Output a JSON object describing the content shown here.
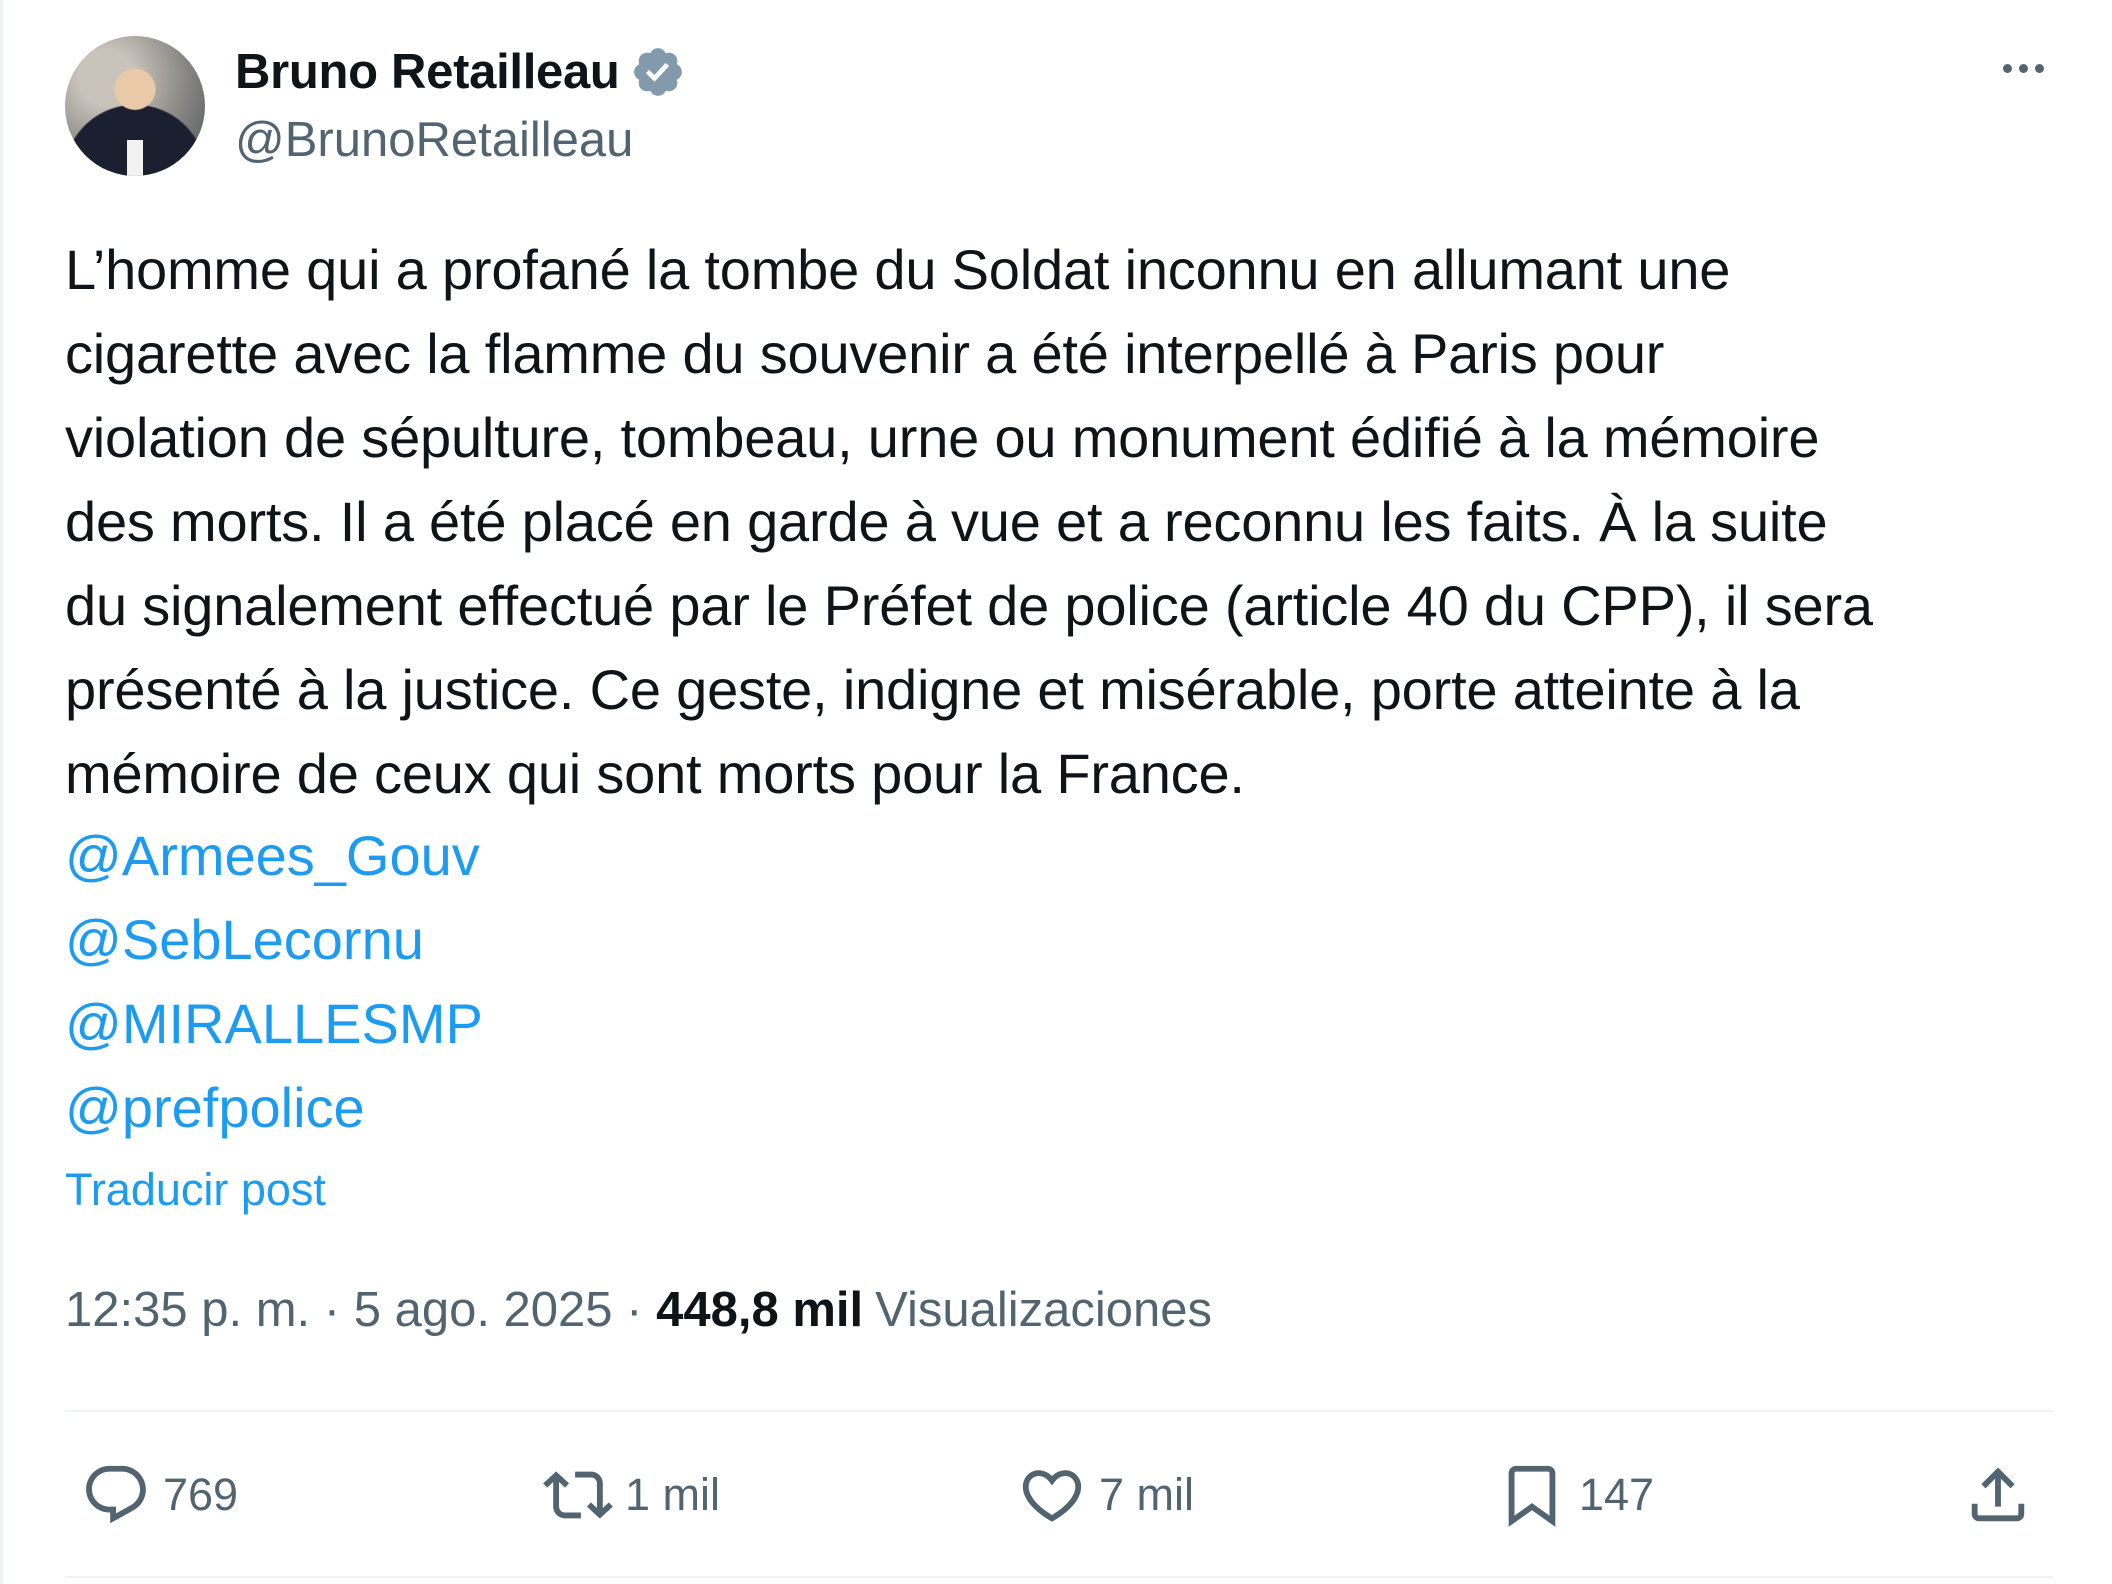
{
  "author": {
    "name": "Bruno Retailleau",
    "handle": "@BrunoRetailleau"
  },
  "body_lines": [
    "L’homme qui a profané la tombe du Soldat inconnu en allumant une",
    "cigarette avec la flamme du souvenir a été interpellé à Paris pour",
    "violation de sépulture, tombeau, urne ou monument édifié à la mémoire",
    "des morts. Il a été placé en garde à vue et a reconnu les faits. À la suite",
    "du signalement effectué par le Préfet de police (article 40 du CPP), il sera",
    "présenté à la justice. Ce geste, indigne et misérable, porte atteinte à la",
    "mémoire de ceux qui sont morts pour la France."
  ],
  "mentions": [
    "@Armees_Gouv",
    "@SebLecornu",
    "@MIRALLESMP",
    "@prefpolice"
  ],
  "translate_label": "Traducir post",
  "meta": {
    "time": "12:35 p. m.",
    "sep1": " · ",
    "date": "5 ago. 2025",
    "sep2": " · ",
    "views_count": "448,8 mil",
    "views_label": "Visualizaciones"
  },
  "actions": {
    "replies": "769",
    "reposts": "1 mil",
    "likes": "7 mil",
    "bookmarks": "147"
  },
  "colors": {
    "link": "#1d9bf0",
    "secondary": "#536471",
    "text": "#0f1419",
    "verified": "#829aab"
  }
}
